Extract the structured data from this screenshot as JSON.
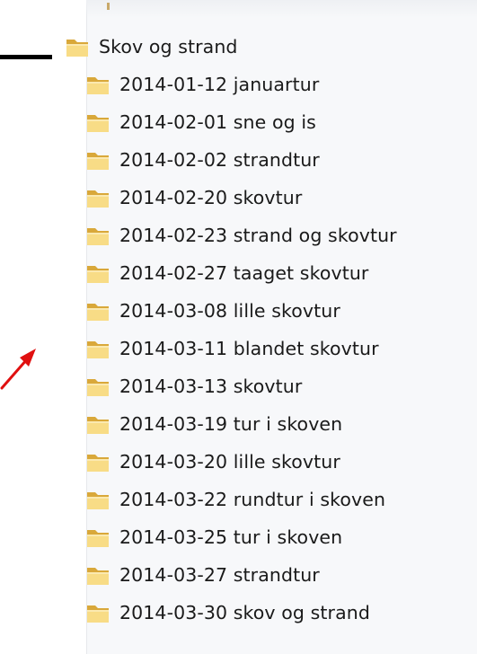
{
  "colors": {
    "folder_light": "#f8dc86",
    "folder_dark": "#d9a83a",
    "arrow": "#e01010",
    "pointer_line": "#000000"
  },
  "tree": {
    "parent": {
      "label": "Skov og strand",
      "icon": "folder-icon"
    },
    "children": [
      {
        "label": "2014-01-12 januartur",
        "icon": "folder-icon"
      },
      {
        "label": "2014-02-01 sne og is",
        "icon": "folder-icon"
      },
      {
        "label": "2014-02-02 strandtur",
        "icon": "folder-icon"
      },
      {
        "label": "2014-02-20 skovtur",
        "icon": "folder-icon"
      },
      {
        "label": "2014-02-23 strand og skovtur",
        "icon": "folder-icon"
      },
      {
        "label": "2014-02-27 taaget skovtur",
        "icon": "folder-icon"
      },
      {
        "label": "2014-03-08 lille skovtur",
        "icon": "folder-icon"
      },
      {
        "label": "2014-03-11 blandet skovtur",
        "icon": "folder-icon"
      },
      {
        "label": "2014-03-13 skovtur",
        "icon": "folder-icon"
      },
      {
        "label": "2014-03-19 tur i skoven",
        "icon": "folder-icon"
      },
      {
        "label": "2014-03-20 lille skovtur",
        "icon": "folder-icon"
      },
      {
        "label": "2014-03-22 rundtur i skoven",
        "icon": "folder-icon"
      },
      {
        "label": "2014-03-25 tur i skoven",
        "icon": "folder-icon"
      },
      {
        "label": "2014-03-27 strandtur",
        "icon": "folder-icon"
      },
      {
        "label": "2014-03-30 skov og strand",
        "icon": "folder-icon"
      }
    ]
  }
}
